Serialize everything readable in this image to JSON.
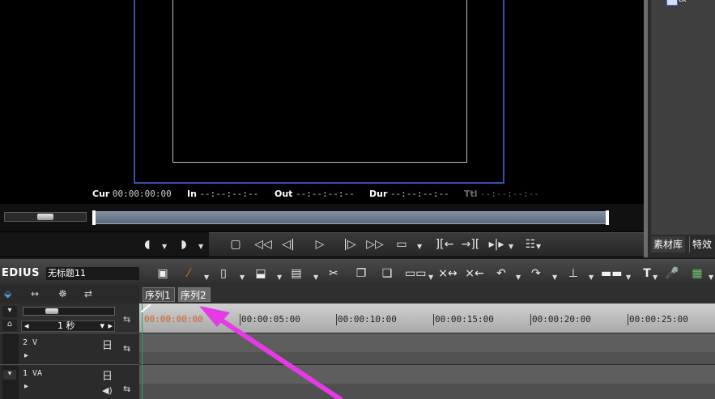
{
  "monitor": {
    "timecodes": [
      {
        "label": "Cur",
        "value": "00:00:00:00",
        "dim": false
      },
      {
        "label": "In",
        "value": "--:--:--:--",
        "dim": false
      },
      {
        "label": "Out",
        "value": "--:--:--:--",
        "dim": false
      },
      {
        "label": "Dur",
        "value": "--:--:--:--",
        "dim": false
      },
      {
        "label": "Ttl",
        "value": "--:--:--:--",
        "dim": true
      }
    ]
  },
  "right_panel": {
    "tabs": [
      "素材库",
      "特效"
    ],
    "top_icon_text": "tk"
  },
  "timeline": {
    "app_name": "EDIUS",
    "project_name": "无标题11",
    "sequence_tabs": [
      "序列1",
      "序列2"
    ],
    "active_sequence": 1,
    "zoom_label": "1 秒",
    "ruler_labels": [
      "00:00:00:00",
      "00:00:05:00",
      "00:00:10:00",
      "00:00:15:00",
      "00:00:20:00",
      "00:00:25:00"
    ],
    "tracks": [
      {
        "name": "2 V",
        "type": "video"
      },
      {
        "name": "1 VA",
        "type": "video-audio"
      }
    ]
  },
  "colors": {
    "annotation_arrow": "#e43be6",
    "cursor_green": "#1ea35a",
    "cur_timecode": "#c8642a",
    "frame_border": "#3a4fa8"
  }
}
